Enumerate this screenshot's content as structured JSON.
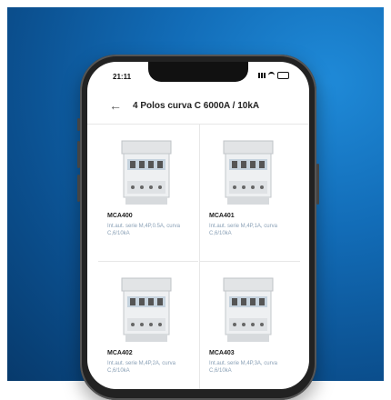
{
  "status_bar": {
    "time": "21:11"
  },
  "header": {
    "back_icon": "arrow-left-icon",
    "title": "4 Polos curva C 6000A / 10kA"
  },
  "products": [
    {
      "code": "MCA400",
      "description": "Int.aut. serie M,4P,0.5A, curva C,6/10kA"
    },
    {
      "code": "MCA401",
      "description": "Int.aut. serie M,4P,1A, curva C,6/10kA"
    },
    {
      "code": "MCA402",
      "description": "Int.aut. serie M,4P,2A, curva C,6/10kA"
    },
    {
      "code": "MCA403",
      "description": "Int.aut. serie M,4P,3A, curva C,6/10kA"
    }
  ],
  "colors": {
    "background_gradient": [
      "#1f8ad8",
      "#0b4f8e"
    ],
    "phone_frame": "#222222",
    "description_text": "#8aa0b6"
  }
}
